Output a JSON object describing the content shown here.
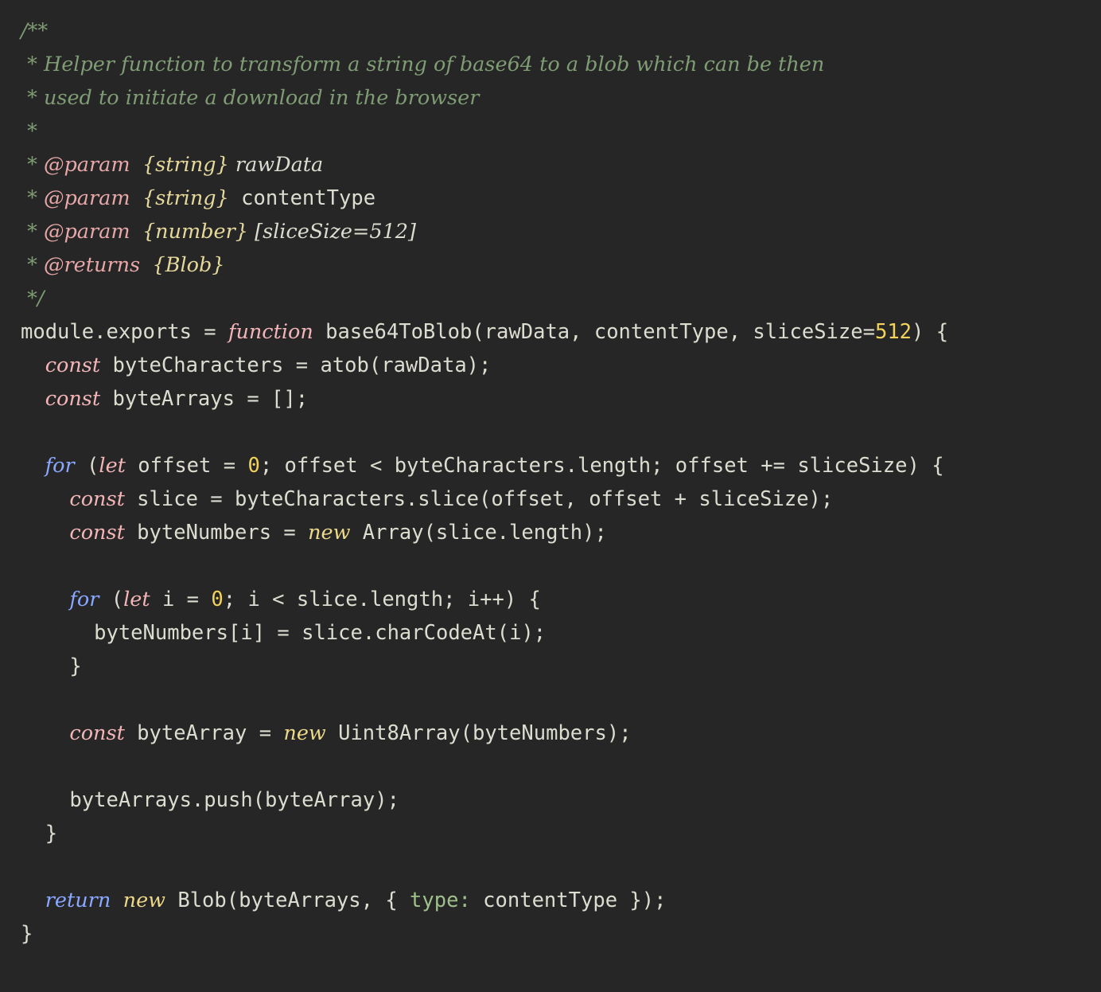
{
  "editor": {
    "theme_colors": {
      "background": "#262626",
      "comment": "#7f9c75",
      "jsdoc_tag": "#e8a7a8",
      "keyword_pink": "#f3b5b8",
      "keyword_blue": "#8aa8ff",
      "keyword_yellow": "#ecd98a",
      "number": "#f2d35a",
      "plain": "#dcdcd0"
    },
    "lines": [
      [
        {
          "t": "/**",
          "c": "comment it"
        }
      ],
      [
        {
          "t": " * Helper function to transform a string of base64 to a blob which can be then",
          "c": "comment it"
        }
      ],
      [
        {
          "t": " * used to initiate a download in the browser",
          "c": "comment it"
        }
      ],
      [
        {
          "t": " *",
          "c": "comment it"
        }
      ],
      [
        {
          "t": " * ",
          "c": "comment it"
        },
        {
          "t": "@param",
          "c": "tag it"
        },
        {
          "t": " ",
          "c": "plain"
        },
        {
          "t": "{string}",
          "c": "type it"
        },
        {
          "t": " rawData",
          "c": "param it"
        }
      ],
      [
        {
          "t": " * ",
          "c": "comment it"
        },
        {
          "t": "@param",
          "c": "tag it"
        },
        {
          "t": " ",
          "c": "plain"
        },
        {
          "t": "{string}",
          "c": "type it"
        },
        {
          "t": " contentType",
          "c": "param"
        }
      ],
      [
        {
          "t": " * ",
          "c": "comment it"
        },
        {
          "t": "@param",
          "c": "tag it"
        },
        {
          "t": " ",
          "c": "plain"
        },
        {
          "t": "{number}",
          "c": "type it"
        },
        {
          "t": " [sliceSize=512]",
          "c": "param it"
        }
      ],
      [
        {
          "t": " * ",
          "c": "comment it"
        },
        {
          "t": "@returns",
          "c": "tag it"
        },
        {
          "t": " ",
          "c": "plain"
        },
        {
          "t": "{Blob}",
          "c": "type it"
        }
      ],
      [
        {
          "t": " */",
          "c": "comment it"
        }
      ],
      [
        {
          "t": "module.exports = ",
          "c": "plain"
        },
        {
          "t": "function",
          "c": "pink it"
        },
        {
          "t": " base64ToBlob(rawData, contentType, sliceSize=",
          "c": "plain"
        },
        {
          "t": "512",
          "c": "num"
        },
        {
          "t": ") {",
          "c": "plain"
        }
      ],
      [
        {
          "t": "  ",
          "c": "plain"
        },
        {
          "t": "const",
          "c": "pink it"
        },
        {
          "t": " byteCharacters = atob(rawData);",
          "c": "plain"
        }
      ],
      [
        {
          "t": "  ",
          "c": "plain"
        },
        {
          "t": "const",
          "c": "pink it"
        },
        {
          "t": " byteArrays = [];",
          "c": "plain"
        }
      ],
      [
        {
          "t": "",
          "c": "plain"
        }
      ],
      [
        {
          "t": "  ",
          "c": "plain"
        },
        {
          "t": "for",
          "c": "blue it"
        },
        {
          "t": " (",
          "c": "plain"
        },
        {
          "t": "let",
          "c": "pink it"
        },
        {
          "t": " offset = ",
          "c": "plain"
        },
        {
          "t": "0",
          "c": "num"
        },
        {
          "t": "; offset < byteCharacters.length; offset += sliceSize) {",
          "c": "plain"
        }
      ],
      [
        {
          "t": "    ",
          "c": "plain"
        },
        {
          "t": "const",
          "c": "pink it"
        },
        {
          "t": " slice = byteCharacters.slice(offset, offset + sliceSize);",
          "c": "plain"
        }
      ],
      [
        {
          "t": "    ",
          "c": "plain"
        },
        {
          "t": "const",
          "c": "pink it"
        },
        {
          "t": " byteNumbers = ",
          "c": "plain"
        },
        {
          "t": "new",
          "c": "yellow it"
        },
        {
          "t": " Array(slice.length);",
          "c": "plain"
        }
      ],
      [
        {
          "t": "",
          "c": "plain"
        }
      ],
      [
        {
          "t": "    ",
          "c": "plain"
        },
        {
          "t": "for",
          "c": "blue it"
        },
        {
          "t": " (",
          "c": "plain"
        },
        {
          "t": "let",
          "c": "pink it"
        },
        {
          "t": " i = ",
          "c": "plain"
        },
        {
          "t": "0",
          "c": "num"
        },
        {
          "t": "; i < slice.length; i++) {",
          "c": "plain"
        }
      ],
      [
        {
          "t": "      byteNumbers[i] = slice.charCodeAt(i);",
          "c": "plain"
        }
      ],
      [
        {
          "t": "    }",
          "c": "plain"
        }
      ],
      [
        {
          "t": "",
          "c": "plain"
        }
      ],
      [
        {
          "t": "    ",
          "c": "plain"
        },
        {
          "t": "const",
          "c": "pink it"
        },
        {
          "t": " byteArray = ",
          "c": "plain"
        },
        {
          "t": "new",
          "c": "yellow it"
        },
        {
          "t": " Uint8Array(byteNumbers);",
          "c": "plain"
        }
      ],
      [
        {
          "t": "",
          "c": "plain"
        }
      ],
      [
        {
          "t": "    byteArrays.push(byteArray);",
          "c": "plain"
        }
      ],
      [
        {
          "t": "  }",
          "c": "plain"
        }
      ],
      [
        {
          "t": "",
          "c": "plain"
        }
      ],
      [
        {
          "t": "  ",
          "c": "plain"
        },
        {
          "t": "return",
          "c": "blue it"
        },
        {
          "t": " ",
          "c": "plain"
        },
        {
          "t": "new",
          "c": "yellow it"
        },
        {
          "t": " Blob(byteArrays, { ",
          "c": "plain"
        },
        {
          "t": "type:",
          "c": "prop"
        },
        {
          "t": " contentType });",
          "c": "plain"
        }
      ],
      [
        {
          "t": "}",
          "c": "plain"
        }
      ]
    ]
  }
}
